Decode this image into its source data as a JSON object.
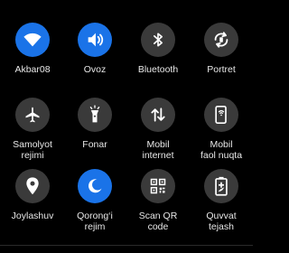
{
  "tiles": [
    {
      "label": "Akbar08",
      "icon": "wifi-icon",
      "active": true
    },
    {
      "label": "Ovoz",
      "icon": "volume-icon",
      "active": true
    },
    {
      "label": "Bluetooth",
      "icon": "bluetooth-icon",
      "active": false
    },
    {
      "label": "Portret",
      "icon": "rotate-icon",
      "active": false
    },
    {
      "label": "Samolyot\nrejimi",
      "icon": "airplane-icon",
      "active": false
    },
    {
      "label": "Fonar",
      "icon": "flashlight-icon",
      "active": false
    },
    {
      "label": "Mobil\ninternet",
      "icon": "mobile-data-icon",
      "active": false
    },
    {
      "label": "Mobil\nfaol nuqta",
      "icon": "hotspot-icon",
      "active": false
    },
    {
      "label": "Joylashuv",
      "icon": "location-icon",
      "active": false
    },
    {
      "label": "Qorong‘i\nrejim",
      "icon": "moon-icon",
      "active": true
    },
    {
      "label": "Scan QR\ncode",
      "icon": "qr-code-icon",
      "active": false
    },
    {
      "label": "Quvvat\ntejash",
      "icon": "battery-saver-icon",
      "active": false
    }
  ],
  "colors": {
    "active": "#1a73e8",
    "inactive": "#3a3a3a",
    "background": "#000000",
    "text": "#e8e8e8"
  }
}
